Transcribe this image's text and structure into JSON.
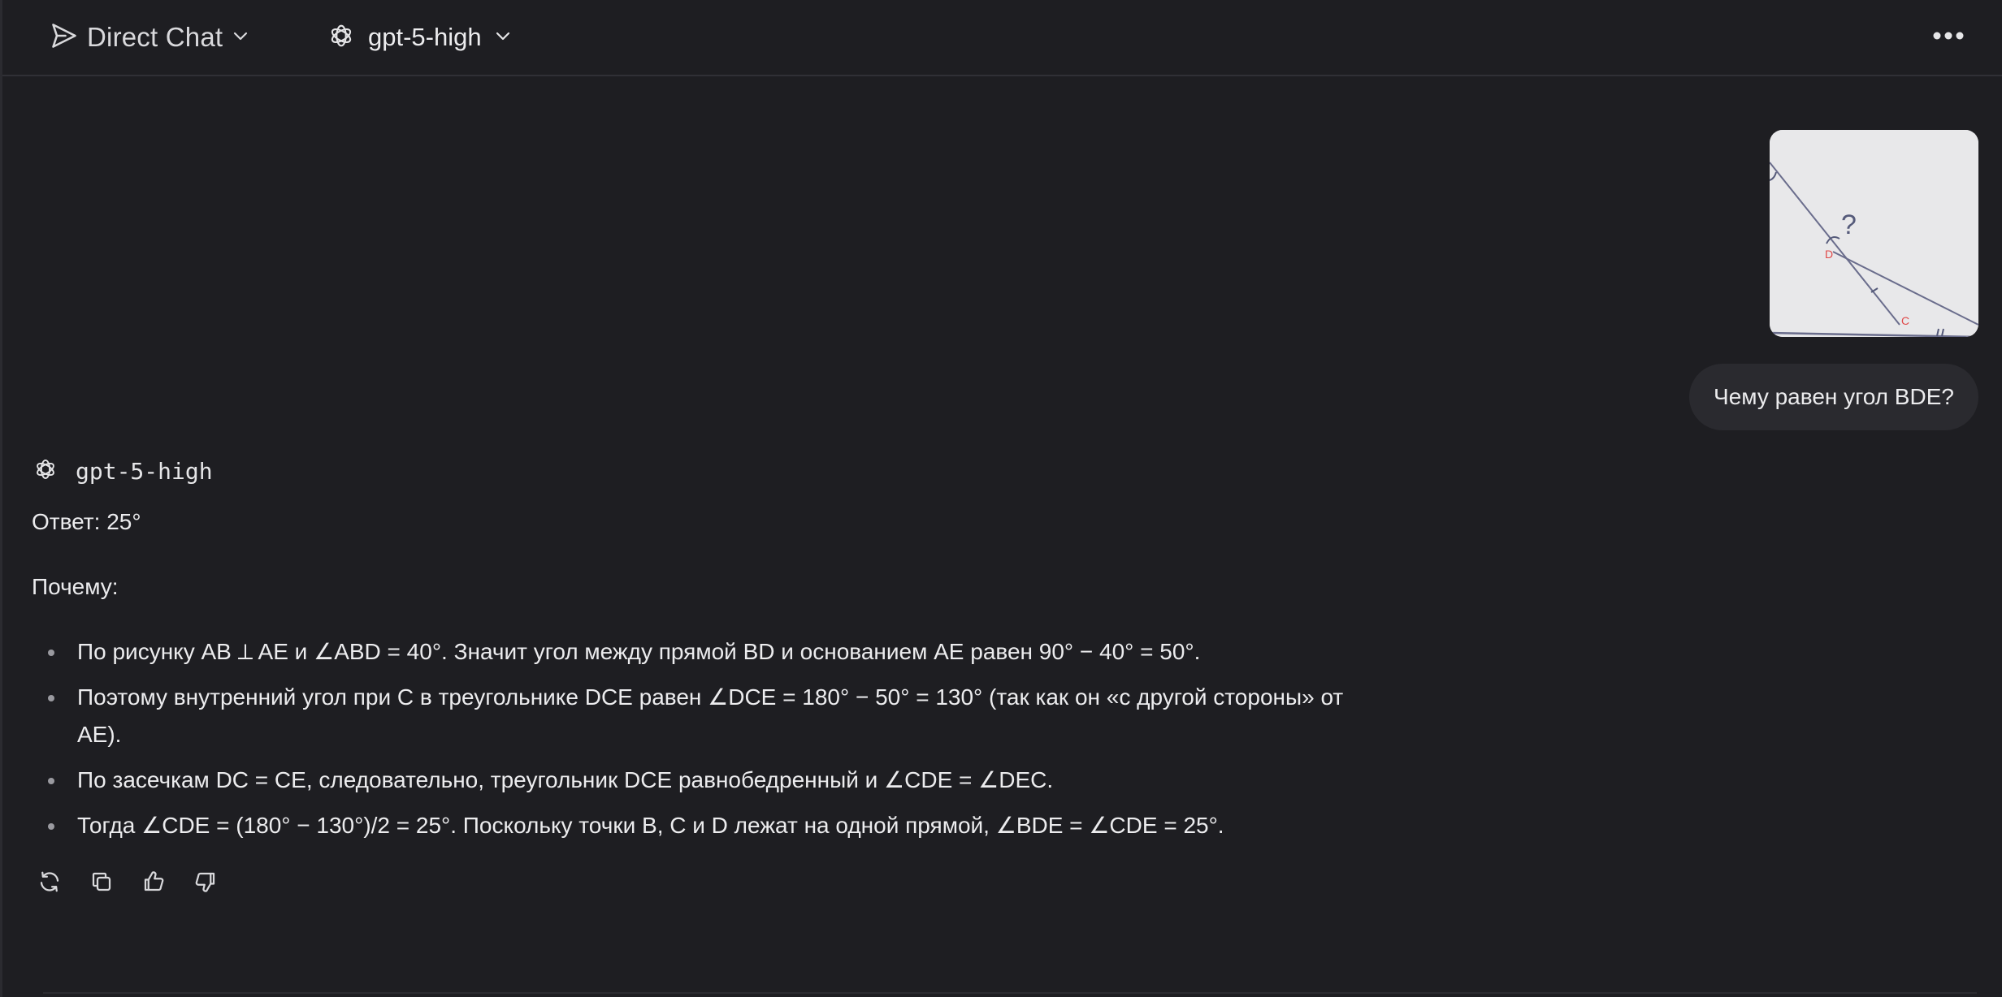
{
  "header": {
    "mode_label": "Direct Chat",
    "model_label": "gpt-5-high"
  },
  "user_message": {
    "text": "Чему равен угол BDE?",
    "image_labels": {
      "point_d": "D",
      "point_c": "C",
      "question_mark": "?"
    }
  },
  "assistant_message": {
    "model_name": "gpt-5-high",
    "answer_line": "Ответ: 25°",
    "why_label": "Почему:",
    "bullets": [
      "По рисунку AB ⟂ AE и ∠ABD = 40°. Значит угол между прямой BD и основанием AE равен 90° − 40° = 50°.",
      "Поэтому внутренний угол при C в треугольнике DCE равен ∠DCE = 180° − 50° = 130° (так как он «с другой стороны» от AE).",
      "По засечкам DC = CE, следовательно, треугольник DCE равнобедренный и ∠CDE = ∠DEC.",
      "Тогда ∠CDE = (180° − 130°)/2 = 25°. Поскольку точки B, C и D лежат на одной прямой, ∠BDE = ∠CDE = 25°."
    ]
  },
  "icons": {
    "mode": "send-icon",
    "model": "openai-logo-icon",
    "more": "more-horizontal-icon",
    "regenerate": "refresh-icon",
    "copy": "copy-icon",
    "like": "thumbs-up-icon",
    "dislike": "thumbs-down-icon"
  }
}
